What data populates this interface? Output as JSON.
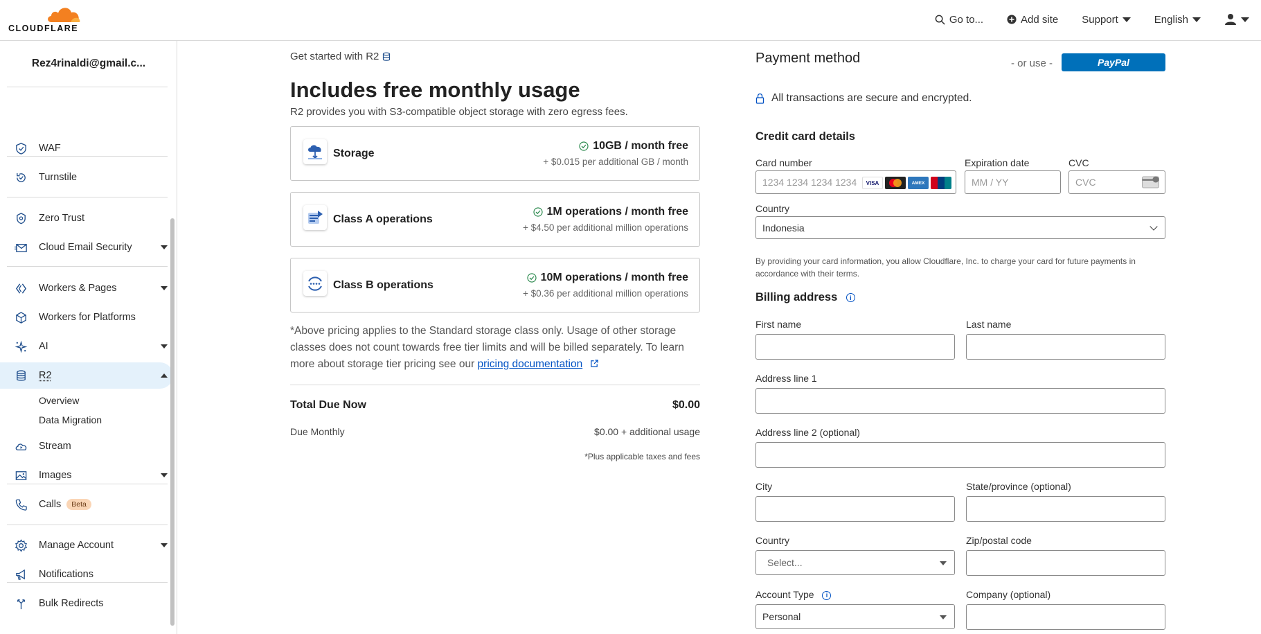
{
  "app": {
    "brand": "CLOUDFLARE"
  },
  "topnav": {
    "goto": "Go to...",
    "add_site": "Add site",
    "support": "Support",
    "language": "English"
  },
  "sidebar": {
    "account": "Rez4rinaldi@gmail.c...",
    "items": [
      {
        "label": "WAF"
      },
      {
        "label": "Turnstile"
      },
      {
        "label": "Zero Trust"
      },
      {
        "label": "Cloud Email Security"
      },
      {
        "label": "Workers & Pages"
      },
      {
        "label": "Workers for Platforms"
      },
      {
        "label": "AI"
      },
      {
        "label": "R2"
      },
      {
        "label": "Stream"
      },
      {
        "label": "Images"
      },
      {
        "label": "Calls",
        "badge": "Beta"
      },
      {
        "label": "Manage Account"
      },
      {
        "label": "Notifications"
      },
      {
        "label": "Bulk Redirects"
      }
    ],
    "r2_sub": [
      "Overview",
      "Data Migration"
    ]
  },
  "main": {
    "breadcrumb": "Get started with R2",
    "title": "Includes free monthly usage",
    "subtitle": "R2 provides you with S3-compatible object storage with zero egress fees.",
    "cards": [
      {
        "title": "Storage",
        "free": "10GB / month free",
        "extra": "+ $0.015 per additional GB / month"
      },
      {
        "title": "Class A operations",
        "free": "1M operations / month free",
        "extra": "+ $4.50 per additional million operations"
      },
      {
        "title": "Class B operations",
        "free": "10M operations / month free",
        "extra": "+ $0.36 per additional million operations"
      }
    ],
    "note_text": "*Above pricing applies to the Standard storage class only. Usage of other storage classes does not count towards free tier limits and will be billed separately. To learn more about storage tier pricing see our",
    "note_link": "pricing documentation",
    "total_label": "Total Due Now",
    "total_value": "$0.00",
    "monthly_label": "Due Monthly",
    "monthly_value": "$0.00 + additional usage",
    "taxes": "*Plus applicable taxes and fees"
  },
  "payment": {
    "title": "Payment method",
    "or_use": "- or use -",
    "paypal": "PayPal",
    "secure": "All transactions are secure and encrypted.",
    "cc_heading": "Credit card details",
    "card_number_label": "Card number",
    "card_number_placeholder": "1234 1234 1234 1234",
    "exp_label": "Expiration date",
    "exp_placeholder": "MM / YY",
    "cvc_label": "CVC",
    "cvc_placeholder": "CVC",
    "cc_country_label": "Country",
    "cc_country_value": "Indonesia",
    "consent": "By providing your card information, you allow Cloudflare, Inc. to charge your card for future payments in accordance with their terms.",
    "billing_heading": "Billing address",
    "first_name_label": "First name",
    "last_name_label": "Last name",
    "address1_label": "Address line 1",
    "address2_label": "Address line 2 (optional)",
    "city_label": "City",
    "state_label": "State/province (optional)",
    "country_label": "Country",
    "country_placeholder": "Select...",
    "zip_label": "Zip/postal code",
    "account_type_label": "Account Type",
    "account_type_value": "Personal",
    "company_label": "Company (optional)",
    "card_brands": [
      "VISA",
      "Mastercard",
      "AMEX",
      "UnionPay"
    ]
  },
  "colors": {
    "accent": "#0051c3",
    "brand_orange": "#f38020",
    "paypal": "#0070ba",
    "active_bg": "#e4f1fb"
  }
}
